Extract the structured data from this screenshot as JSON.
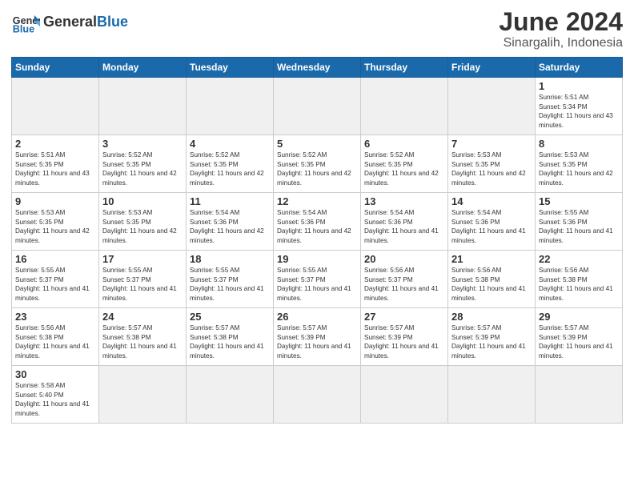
{
  "header": {
    "logo_general": "General",
    "logo_blue": "Blue",
    "month_title": "June 2024",
    "location": "Sinargalih, Indonesia"
  },
  "weekdays": [
    "Sunday",
    "Monday",
    "Tuesday",
    "Wednesday",
    "Thursday",
    "Friday",
    "Saturday"
  ],
  "weeks": [
    [
      {
        "day": "",
        "empty": true
      },
      {
        "day": "",
        "empty": true
      },
      {
        "day": "",
        "empty": true
      },
      {
        "day": "",
        "empty": true
      },
      {
        "day": "",
        "empty": true
      },
      {
        "day": "",
        "empty": true
      },
      {
        "day": "1",
        "sunrise": "Sunrise: 5:51 AM",
        "sunset": "Sunset: 5:34 PM",
        "daylight": "Daylight: 11 hours and 43 minutes."
      }
    ],
    [
      {
        "day": "2",
        "sunrise": "Sunrise: 5:51 AM",
        "sunset": "Sunset: 5:35 PM",
        "daylight": "Daylight: 11 hours and 43 minutes."
      },
      {
        "day": "3",
        "sunrise": "Sunrise: 5:52 AM",
        "sunset": "Sunset: 5:35 PM",
        "daylight": "Daylight: 11 hours and 42 minutes."
      },
      {
        "day": "4",
        "sunrise": "Sunrise: 5:52 AM",
        "sunset": "Sunset: 5:35 PM",
        "daylight": "Daylight: 11 hours and 42 minutes."
      },
      {
        "day": "5",
        "sunrise": "Sunrise: 5:52 AM",
        "sunset": "Sunset: 5:35 PM",
        "daylight": "Daylight: 11 hours and 42 minutes."
      },
      {
        "day": "6",
        "sunrise": "Sunrise: 5:52 AM",
        "sunset": "Sunset: 5:35 PM",
        "daylight": "Daylight: 11 hours and 42 minutes."
      },
      {
        "day": "7",
        "sunrise": "Sunrise: 5:53 AM",
        "sunset": "Sunset: 5:35 PM",
        "daylight": "Daylight: 11 hours and 42 minutes."
      },
      {
        "day": "8",
        "sunrise": "Sunrise: 5:53 AM",
        "sunset": "Sunset: 5:35 PM",
        "daylight": "Daylight: 11 hours and 42 minutes."
      }
    ],
    [
      {
        "day": "9",
        "sunrise": "Sunrise: 5:53 AM",
        "sunset": "Sunset: 5:35 PM",
        "daylight": "Daylight: 11 hours and 42 minutes."
      },
      {
        "day": "10",
        "sunrise": "Sunrise: 5:53 AM",
        "sunset": "Sunset: 5:35 PM",
        "daylight": "Daylight: 11 hours and 42 minutes."
      },
      {
        "day": "11",
        "sunrise": "Sunrise: 5:54 AM",
        "sunset": "Sunset: 5:36 PM",
        "daylight": "Daylight: 11 hours and 42 minutes."
      },
      {
        "day": "12",
        "sunrise": "Sunrise: 5:54 AM",
        "sunset": "Sunset: 5:36 PM",
        "daylight": "Daylight: 11 hours and 42 minutes."
      },
      {
        "day": "13",
        "sunrise": "Sunrise: 5:54 AM",
        "sunset": "Sunset: 5:36 PM",
        "daylight": "Daylight: 11 hours and 41 minutes."
      },
      {
        "day": "14",
        "sunrise": "Sunrise: 5:54 AM",
        "sunset": "Sunset: 5:36 PM",
        "daylight": "Daylight: 11 hours and 41 minutes."
      },
      {
        "day": "15",
        "sunrise": "Sunrise: 5:55 AM",
        "sunset": "Sunset: 5:36 PM",
        "daylight": "Daylight: 11 hours and 41 minutes."
      }
    ],
    [
      {
        "day": "16",
        "sunrise": "Sunrise: 5:55 AM",
        "sunset": "Sunset: 5:37 PM",
        "daylight": "Daylight: 11 hours and 41 minutes."
      },
      {
        "day": "17",
        "sunrise": "Sunrise: 5:55 AM",
        "sunset": "Sunset: 5:37 PM",
        "daylight": "Daylight: 11 hours and 41 minutes."
      },
      {
        "day": "18",
        "sunrise": "Sunrise: 5:55 AM",
        "sunset": "Sunset: 5:37 PM",
        "daylight": "Daylight: 11 hours and 41 minutes."
      },
      {
        "day": "19",
        "sunrise": "Sunrise: 5:55 AM",
        "sunset": "Sunset: 5:37 PM",
        "daylight": "Daylight: 11 hours and 41 minutes."
      },
      {
        "day": "20",
        "sunrise": "Sunrise: 5:56 AM",
        "sunset": "Sunset: 5:37 PM",
        "daylight": "Daylight: 11 hours and 41 minutes."
      },
      {
        "day": "21",
        "sunrise": "Sunrise: 5:56 AM",
        "sunset": "Sunset: 5:38 PM",
        "daylight": "Daylight: 11 hours and 41 minutes."
      },
      {
        "day": "22",
        "sunrise": "Sunrise: 5:56 AM",
        "sunset": "Sunset: 5:38 PM",
        "daylight": "Daylight: 11 hours and 41 minutes."
      }
    ],
    [
      {
        "day": "23",
        "sunrise": "Sunrise: 5:56 AM",
        "sunset": "Sunset: 5:38 PM",
        "daylight": "Daylight: 11 hours and 41 minutes."
      },
      {
        "day": "24",
        "sunrise": "Sunrise: 5:57 AM",
        "sunset": "Sunset: 5:38 PM",
        "daylight": "Daylight: 11 hours and 41 minutes."
      },
      {
        "day": "25",
        "sunrise": "Sunrise: 5:57 AM",
        "sunset": "Sunset: 5:38 PM",
        "daylight": "Daylight: 11 hours and 41 minutes."
      },
      {
        "day": "26",
        "sunrise": "Sunrise: 5:57 AM",
        "sunset": "Sunset: 5:39 PM",
        "daylight": "Daylight: 11 hours and 41 minutes."
      },
      {
        "day": "27",
        "sunrise": "Sunrise: 5:57 AM",
        "sunset": "Sunset: 5:39 PM",
        "daylight": "Daylight: 11 hours and 41 minutes."
      },
      {
        "day": "28",
        "sunrise": "Sunrise: 5:57 AM",
        "sunset": "Sunset: 5:39 PM",
        "daylight": "Daylight: 11 hours and 41 minutes."
      },
      {
        "day": "29",
        "sunrise": "Sunrise: 5:57 AM",
        "sunset": "Sunset: 5:39 PM",
        "daylight": "Daylight: 11 hours and 41 minutes."
      }
    ],
    [
      {
        "day": "30",
        "sunrise": "Sunrise: 5:58 AM",
        "sunset": "Sunset: 5:40 PM",
        "daylight": "Daylight: 11 hours and 41 minutes."
      },
      {
        "day": "",
        "empty": true
      },
      {
        "day": "",
        "empty": true
      },
      {
        "day": "",
        "empty": true
      },
      {
        "day": "",
        "empty": true
      },
      {
        "day": "",
        "empty": true
      },
      {
        "day": "",
        "empty": true
      }
    ]
  ]
}
